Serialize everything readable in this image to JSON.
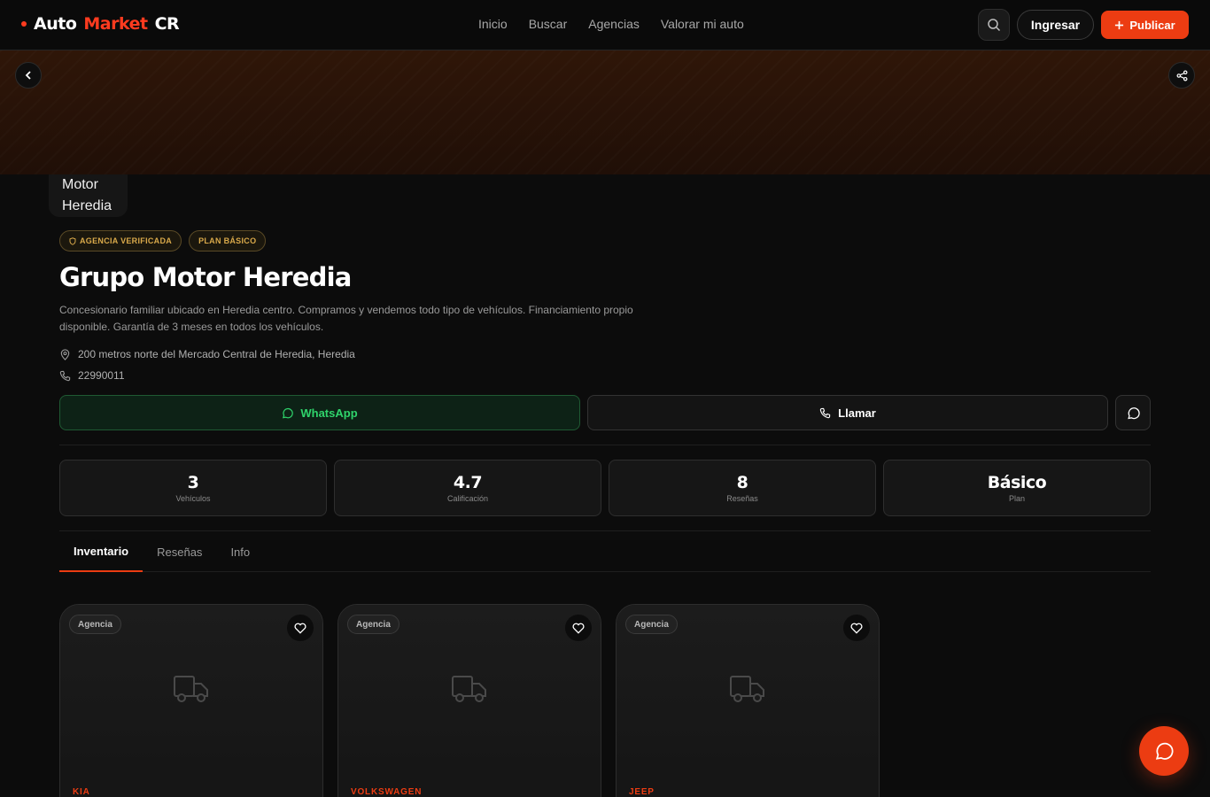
{
  "brand": {
    "word1": "Auto",
    "word2": "Market",
    "word3": "CR"
  },
  "nav": [
    "Inicio",
    "Buscar",
    "Agencias",
    "Valorar mi auto"
  ],
  "header": {
    "login_label": "Ingresar",
    "publish_label": "Publicar"
  },
  "agency": {
    "logo_line1": "Motor",
    "logo_line2": "Heredia",
    "badges": [
      "AGENCIA VERIFICADA",
      "PLAN BÁSICO"
    ],
    "name": "Grupo Motor Heredia",
    "description": "Concesionario familiar ubicado en Heredia centro. Compramos y vendemos todo tipo de vehículos. Financiamiento propio disponible. Garantía de 3 meses en todos los vehículos.",
    "address": "200 metros norte del Mercado Central de Heredia, Heredia",
    "phone": "22990011"
  },
  "actions": {
    "whatsapp_label": "WhatsApp",
    "call_label": "Llamar"
  },
  "stats": [
    {
      "value": "3",
      "label": "Vehículos"
    },
    {
      "value": "4.7",
      "label": "Calificación"
    },
    {
      "value": "8",
      "label": "Reseñas"
    },
    {
      "value": "Básico",
      "label": "Plan"
    }
  ],
  "tabs": [
    "Inventario",
    "Reseñas",
    "Info"
  ],
  "cards": [
    {
      "tag": "Agencia",
      "make": "KIA"
    },
    {
      "tag": "Agencia",
      "make": "VOLKSWAGEN"
    },
    {
      "tag": "Agencia",
      "make": "JEEP"
    }
  ],
  "colors": {
    "accent": "#ec3c12",
    "whatsapp": "#2fd36b",
    "badge": "#d9a94a"
  }
}
